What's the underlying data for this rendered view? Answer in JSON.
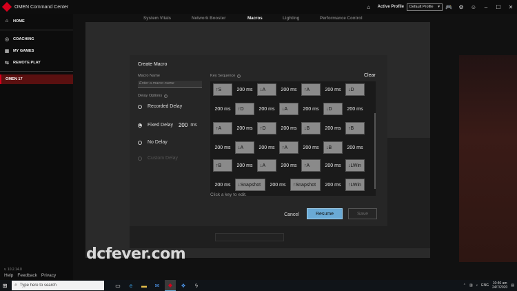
{
  "app": {
    "title": "OMEN Command Center"
  },
  "titlebar": {
    "active_profile_label": "Active Profile",
    "profile_value": "Default Profile"
  },
  "sidebar": {
    "items": [
      {
        "label": "HOME",
        "icon": "home-icon"
      },
      {
        "label": "COACHING",
        "icon": "target-icon"
      },
      {
        "label": "MY GAMES",
        "icon": "grid-icon"
      },
      {
        "label": "REMOTE PLAY",
        "icon": "remote-icon"
      }
    ],
    "device": "OMEN 17",
    "version": "v. 10.2.14.0",
    "links": [
      "Help",
      "Feedback",
      "Privacy"
    ]
  },
  "tabs": [
    "System Vitals",
    "Network Booster",
    "Macros",
    "Lighting",
    "Performance Control"
  ],
  "active_tab": "Macros",
  "modal": {
    "title": "Create Macro",
    "macro_name_label": "Macro Name",
    "macro_name_placeholder": "Enter a macro name",
    "delay_options_label": "Delay Options",
    "options": [
      "Recorded Delay",
      "Fixed Delay",
      "No Delay",
      "Custom Delay"
    ],
    "selected_option": "Fixed Delay",
    "fixed_delay_value": "200",
    "fixed_delay_unit": "ms",
    "key_sequence_label": "Key Sequence",
    "clear_label": "Clear",
    "edit_hint": "Click a key to edit.",
    "cancel_label": "Cancel",
    "resume_label": "Resume",
    "save_label": "Save",
    "sequence_rows": [
      [
        "↑S",
        "200 ms",
        "↓A",
        "200 ms",
        "↑A",
        "200 ms",
        "↓D"
      ],
      [
        "200 ms",
        "↑D",
        "200 ms",
        "↓A",
        "200 ms",
        "↓D",
        "200 ms"
      ],
      [
        "↑A",
        "200 ms",
        "↑D",
        "200 ms",
        "↓B",
        "200 ms",
        "↑B"
      ],
      [
        "200 ms",
        "↓A",
        "200 ms",
        "↑A",
        "200 ms",
        "↓B",
        "200 ms"
      ],
      [
        "↑B",
        "200 ms",
        "↓A",
        "200 ms",
        "↑A",
        "200 ms",
        "↓LWin"
      ],
      [
        "200 ms",
        "↓Snapshot",
        "200 ms",
        "↑Snapshot",
        "200 ms",
        "↑LWin"
      ]
    ]
  },
  "watermark": "dcfever.com",
  "taskbar": {
    "search_placeholder": "Type here to search",
    "language": "ENG",
    "time": "10:46 am",
    "date": "24/7/2020"
  }
}
